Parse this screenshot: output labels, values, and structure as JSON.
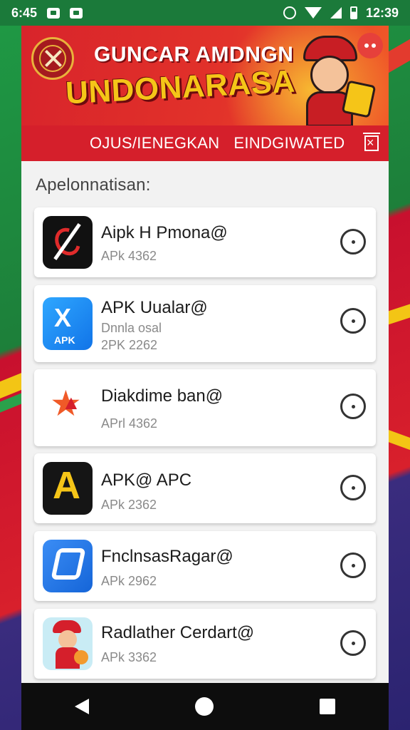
{
  "status_bar": {
    "time_left": "6:45",
    "time_right": "12:39"
  },
  "banner": {
    "title_line1": "GUNCAR AMDNGN",
    "title_line2": "UNDONARASA"
  },
  "tabs": [
    {
      "label": "OJUS/IENEGKAN"
    },
    {
      "label": "EINDGIWATED"
    }
  ],
  "section": {
    "title": "Apelonnatisan:"
  },
  "apps": [
    {
      "title": "Aipk H Pmona@",
      "lines": [
        "APk 4362"
      ],
      "icon": "dark-swirl-icon"
    },
    {
      "title": "APK Uualar@",
      "lines": [
        "Dnnla osal",
        "2PK 2262"
      ],
      "icon": "blue-apk-icon"
    },
    {
      "title": "Diakdime ban@",
      "lines": [
        "APrl 4362"
      ],
      "icon": "star-logo-icon"
    },
    {
      "title": "APK@ APC",
      "lines": [
        "APk 2362"
      ],
      "icon": "yellow-a-icon"
    },
    {
      "title": "FnclnsasRagar@",
      "lines": [
        "APk 2962"
      ],
      "icon": "blue-s-icon"
    },
    {
      "title": "Radlather Cerdart@",
      "lines": [
        "APk 3362"
      ],
      "icon": "mascot-icon"
    }
  ],
  "colors": {
    "accent": "#d51f2b",
    "status": "#1b7a3a",
    "title_yellow": "#f5c518"
  }
}
